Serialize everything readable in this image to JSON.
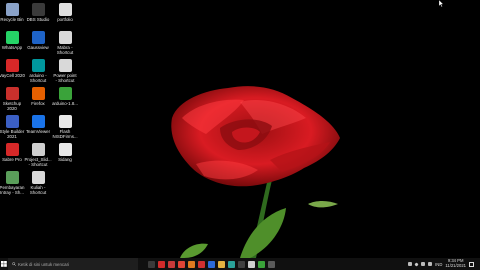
{
  "desktop": {
    "icons": [
      {
        "label": "Recycle Bin",
        "icon": "recycle-bin-icon",
        "color": "#8aa2c8"
      },
      {
        "label": "DBS Studio",
        "icon": "dbs-studio-icon",
        "color": "#3a3a3a"
      },
      {
        "label": "portfolio",
        "icon": "file-icon",
        "color": "#e0e0e0"
      },
      {
        "label": "WhatsApp",
        "icon": "whatsapp-icon",
        "color": "#25d366"
      },
      {
        "label": "Gaussview",
        "icon": "gaussview-icon",
        "color": "#1e63c7"
      },
      {
        "label": "Mabra -\nShortcut",
        "icon": "shortcut-icon",
        "color": "#d9d9d9"
      },
      {
        "label": "VayCell 2020",
        "icon": "app-icon",
        "color": "#d72828"
      },
      {
        "label": "arduino -\nShortcut",
        "icon": "arduino-icon",
        "color": "#00979d"
      },
      {
        "label": "Power point\n- Shortcut",
        "icon": "shortcut-icon",
        "color": "#d9d9d9"
      },
      {
        "label": "Sketchup\n2020",
        "icon": "sketchup-icon",
        "color": "#c9302c"
      },
      {
        "label": "Firefox",
        "icon": "firefox-icon",
        "color": "#e66000"
      },
      {
        "label": "arduino-1.8...",
        "icon": "file-icon",
        "color": "#3aa33a"
      },
      {
        "label": "Style Builder\n2021",
        "icon": "style-builder-icon",
        "color": "#3b5fc4"
      },
      {
        "label": "TeamViewer",
        "icon": "teamviewer-icon",
        "color": "#1a73e8"
      },
      {
        "label": "Flash\nNISDFirms...",
        "icon": "file-icon",
        "color": "#e8e8e8"
      },
      {
        "label": "Sabre Pro",
        "icon": "app-icon",
        "color": "#d62828"
      },
      {
        "label": "Project_Slid...\n- Shortcut",
        "icon": "shortcut-icon",
        "color": "#cfcfcf"
      },
      {
        "label": "Sidang",
        "icon": "file-icon",
        "color": "#e8e8e8"
      },
      {
        "label": "Pembayaran\nIntray - Sh...",
        "icon": "shortcut-icon",
        "color": "#5a9e5a"
      },
      {
        "label": "Kuliah -\nShortcut",
        "icon": "shortcut-icon",
        "color": "#d9d9d9"
      }
    ]
  },
  "taskbar": {
    "search_placeholder": "Ketik di sini untuk mencari",
    "apps": [
      {
        "name": "task-view",
        "color": "#3a3a3a"
      },
      {
        "name": "app-red-1",
        "color": "#d22b2b"
      },
      {
        "name": "app-red-2",
        "color": "#c83a3a"
      },
      {
        "name": "chrome",
        "color": "#e04436"
      },
      {
        "name": "app-orange",
        "color": "#e07a20"
      },
      {
        "name": "app-red-3",
        "color": "#d03030"
      },
      {
        "name": "app-blue",
        "color": "#2b6ad9"
      },
      {
        "name": "explorer",
        "color": "#e3b341"
      },
      {
        "name": "app-teal",
        "color": "#2aa39a"
      },
      {
        "name": "app-dark",
        "color": "#404040"
      },
      {
        "name": "app-white",
        "color": "#cfcfcf"
      },
      {
        "name": "app-green",
        "color": "#3aa33a"
      },
      {
        "name": "app-gray",
        "color": "#5a5a5a"
      }
    ],
    "tray": {
      "lang": "IND",
      "time": "9:34 PM",
      "date": "11/21/2021"
    }
  }
}
